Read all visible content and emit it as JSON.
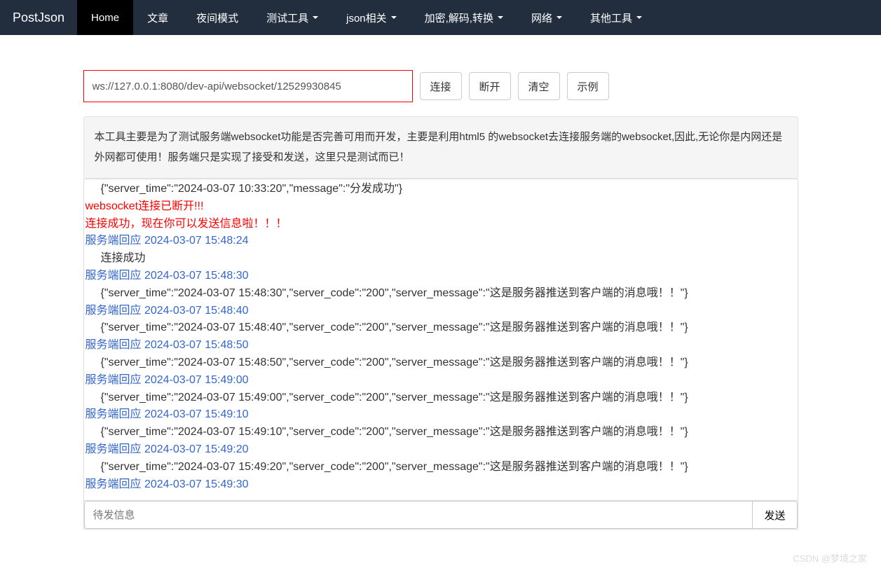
{
  "navbar": {
    "brand": "PostJson",
    "items": [
      {
        "label": "Home",
        "active": true,
        "dropdown": false
      },
      {
        "label": "文章",
        "active": false,
        "dropdown": false
      },
      {
        "label": "夜间模式",
        "active": false,
        "dropdown": false
      },
      {
        "label": "测试工具",
        "active": false,
        "dropdown": true
      },
      {
        "label": "json相关",
        "active": false,
        "dropdown": true
      },
      {
        "label": "加密,解码,转换",
        "active": false,
        "dropdown": true
      },
      {
        "label": "网络",
        "active": false,
        "dropdown": true
      },
      {
        "label": "其他工具",
        "active": false,
        "dropdown": true
      }
    ]
  },
  "toolbar": {
    "url_value": "ws://127.0.0.1:8080/dev-api/websocket/12529930845",
    "connect_label": "连接",
    "disconnect_label": "断开",
    "clear_label": "清空",
    "example_label": "示例"
  },
  "description": "本工具主要是为了测试服务端websocket功能是否完善可用而开发，主要是利用html5 的websocket去连接服务端的websocket,因此,无论你是内网还是外网都可使用！服务端只是实现了接受和发送，这里只是测试而已！",
  "logs": [
    {
      "type": "indent",
      "text": "{\"server_time\":\"2024-03-07 10:33:20\",\"message\":\"分发成功\"}"
    },
    {
      "type": "red",
      "text": "websocket连接已断开!!!"
    },
    {
      "type": "red",
      "text": "连接成功，现在你可以发送信息啦！！！"
    },
    {
      "type": "blue",
      "text": "服务端回应 2024-03-07 15:48:24"
    },
    {
      "type": "indent",
      "text": "连接成功"
    },
    {
      "type": "blue",
      "text": "服务端回应 2024-03-07 15:48:30"
    },
    {
      "type": "indent",
      "text": "{\"server_time\":\"2024-03-07 15:48:30\",\"server_code\":\"200\",\"server_message\":\"这是服务器推送到客户端的消息哦！！\"}"
    },
    {
      "type": "blue",
      "text": "服务端回应 2024-03-07 15:48:40"
    },
    {
      "type": "indent",
      "text": "{\"server_time\":\"2024-03-07 15:48:40\",\"server_code\":\"200\",\"server_message\":\"这是服务器推送到客户端的消息哦！！\"}"
    },
    {
      "type": "blue",
      "text": "服务端回应 2024-03-07 15:48:50"
    },
    {
      "type": "indent",
      "text": "{\"server_time\":\"2024-03-07 15:48:50\",\"server_code\":\"200\",\"server_message\":\"这是服务器推送到客户端的消息哦！！\"}"
    },
    {
      "type": "blue",
      "text": "服务端回应 2024-03-07 15:49:00"
    },
    {
      "type": "indent",
      "text": "{\"server_time\":\"2024-03-07 15:49:00\",\"server_code\":\"200\",\"server_message\":\"这是服务器推送到客户端的消息哦！！\"}"
    },
    {
      "type": "blue",
      "text": "服务端回应 2024-03-07 15:49:10"
    },
    {
      "type": "indent",
      "text": "{\"server_time\":\"2024-03-07 15:49:10\",\"server_code\":\"200\",\"server_message\":\"这是服务器推送到客户端的消息哦！！\"}"
    },
    {
      "type": "blue",
      "text": "服务端回应 2024-03-07 15:49:20"
    },
    {
      "type": "indent",
      "text": "{\"server_time\":\"2024-03-07 15:49:20\",\"server_code\":\"200\",\"server_message\":\"这是服务器推送到客户端的消息哦！！\"}"
    },
    {
      "type": "blue",
      "text": "服务端回应 2024-03-07 15:49:30"
    }
  ],
  "send": {
    "placeholder": "待发信息",
    "button_label": "发送"
  },
  "watermark": "CSDN @梦境之家"
}
